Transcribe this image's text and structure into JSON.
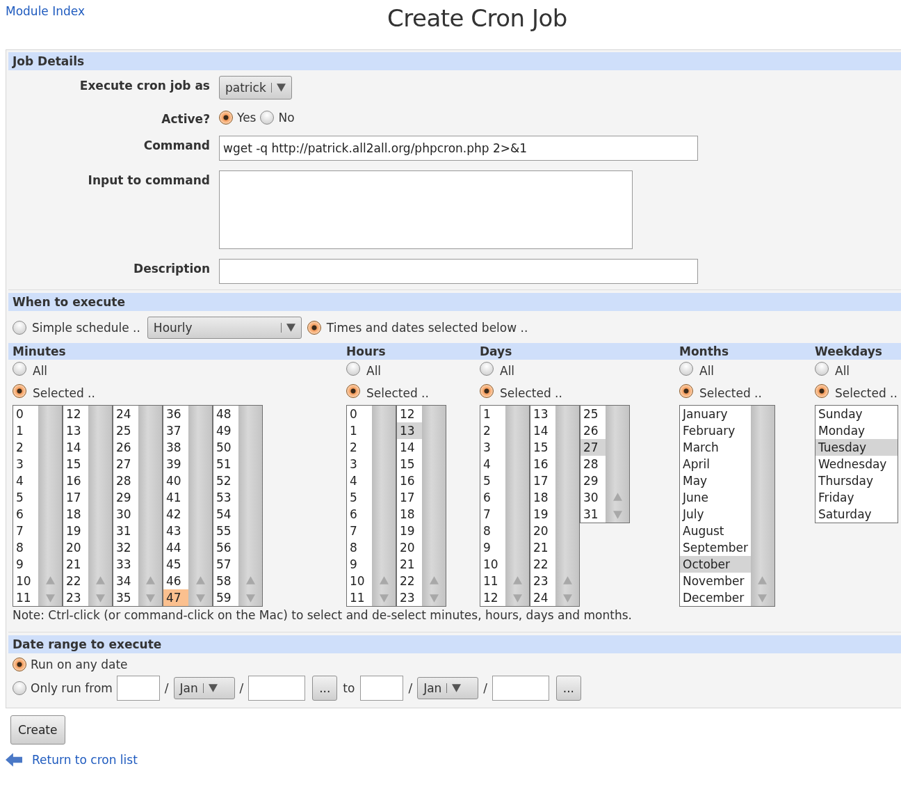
{
  "header": {
    "link": "Module Index",
    "title": "Create Cron Job"
  },
  "job_details": {
    "title": "Job Details",
    "user": {
      "label": "Execute cron job as",
      "value": "patrick"
    },
    "active": {
      "label": "Active?",
      "options": [
        {
          "label": "Yes",
          "selected": true
        },
        {
          "label": "No",
          "selected": false
        }
      ]
    },
    "command": {
      "label": "Command",
      "value": "wget -q http://patrick.all2all.org/phpcron.php 2>&1"
    },
    "input": {
      "label": "Input to command"
    },
    "description": {
      "label": "Description"
    }
  },
  "when": {
    "title": "When to execute",
    "modes": [
      {
        "kind": "simple",
        "label": "Simple schedule ..",
        "selected": false,
        "value": "Hourly"
      },
      {
        "kind": "times",
        "label": "Times and dates selected below ..",
        "selected": true
      }
    ],
    "groups": [
      {
        "title": "Minutes",
        "focused": true,
        "options": [
          {
            "label": "All",
            "selected": false
          },
          {
            "label": "Selected ..",
            "selected": true
          }
        ],
        "lists": [
          {
            "scrollbar": true,
            "items": [
              {
                "label": "0",
                "selected": false
              },
              {
                "label": "1",
                "selected": false
              },
              {
                "label": "2",
                "selected": false
              },
              {
                "label": "3",
                "selected": false
              },
              {
                "label": "4",
                "selected": false
              },
              {
                "label": "5",
                "selected": false
              },
              {
                "label": "6",
                "selected": false
              },
              {
                "label": "7",
                "selected": false
              },
              {
                "label": "8",
                "selected": false
              },
              {
                "label": "9",
                "selected": false
              },
              {
                "label": "10",
                "selected": false
              },
              {
                "label": "11",
                "selected": false
              }
            ]
          },
          {
            "scrollbar": true,
            "items": [
              {
                "label": "12",
                "selected": false
              },
              {
                "label": "13",
                "selected": false
              },
              {
                "label": "14",
                "selected": false
              },
              {
                "label": "15",
                "selected": false
              },
              {
                "label": "16",
                "selected": false
              },
              {
                "label": "17",
                "selected": false
              },
              {
                "label": "18",
                "selected": false
              },
              {
                "label": "19",
                "selected": false
              },
              {
                "label": "20",
                "selected": false
              },
              {
                "label": "21",
                "selected": false
              },
              {
                "label": "22",
                "selected": false
              },
              {
                "label": "23",
                "selected": false
              }
            ]
          },
          {
            "scrollbar": true,
            "items": [
              {
                "label": "24",
                "selected": false
              },
              {
                "label": "25",
                "selected": false
              },
              {
                "label": "26",
                "selected": false
              },
              {
                "label": "27",
                "selected": false
              },
              {
                "label": "28",
                "selected": false
              },
              {
                "label": "29",
                "selected": false
              },
              {
                "label": "30",
                "selected": false
              },
              {
                "label": "31",
                "selected": false
              },
              {
                "label": "32",
                "selected": false
              },
              {
                "label": "33",
                "selected": false
              },
              {
                "label": "34",
                "selected": false
              },
              {
                "label": "35",
                "selected": false
              }
            ]
          },
          {
            "scrollbar": true,
            "items": [
              {
                "label": "36",
                "selected": false
              },
              {
                "label": "37",
                "selected": false
              },
              {
                "label": "38",
                "selected": false
              },
              {
                "label": "39",
                "selected": false
              },
              {
                "label": "40",
                "selected": false
              },
              {
                "label": "41",
                "selected": false
              },
              {
                "label": "42",
                "selected": false
              },
              {
                "label": "43",
                "selected": false
              },
              {
                "label": "44",
                "selected": false
              },
              {
                "label": "45",
                "selected": false
              },
              {
                "label": "46",
                "selected": false
              },
              {
                "label": "47",
                "selected": true
              }
            ]
          },
          {
            "scrollbar": true,
            "items": [
              {
                "label": "48",
                "selected": false
              },
              {
                "label": "49",
                "selected": false
              },
              {
                "label": "50",
                "selected": false
              },
              {
                "label": "51",
                "selected": false
              },
              {
                "label": "52",
                "selected": false
              },
              {
                "label": "53",
                "selected": false
              },
              {
                "label": "54",
                "selected": false
              },
              {
                "label": "55",
                "selected": false
              },
              {
                "label": "56",
                "selected": false
              },
              {
                "label": "57",
                "selected": false
              },
              {
                "label": "58",
                "selected": false
              },
              {
                "label": "59",
                "selected": false
              }
            ]
          }
        ]
      },
      {
        "title": "Hours",
        "focused": false,
        "options": [
          {
            "label": "All",
            "selected": false
          },
          {
            "label": "Selected ..",
            "selected": true
          }
        ],
        "lists": [
          {
            "scrollbar": true,
            "items": [
              {
                "label": "0",
                "selected": false
              },
              {
                "label": "1",
                "selected": false
              },
              {
                "label": "2",
                "selected": false
              },
              {
                "label": "3",
                "selected": false
              },
              {
                "label": "4",
                "selected": false
              },
              {
                "label": "5",
                "selected": false
              },
              {
                "label": "6",
                "selected": false
              },
              {
                "label": "7",
                "selected": false
              },
              {
                "label": "8",
                "selected": false
              },
              {
                "label": "9",
                "selected": false
              },
              {
                "label": "10",
                "selected": false
              },
              {
                "label": "11",
                "selected": false
              }
            ]
          },
          {
            "scrollbar": true,
            "items": [
              {
                "label": "12",
                "selected": false
              },
              {
                "label": "13",
                "selected": true
              },
              {
                "label": "14",
                "selected": false
              },
              {
                "label": "15",
                "selected": false
              },
              {
                "label": "16",
                "selected": false
              },
              {
                "label": "17",
                "selected": false
              },
              {
                "label": "18",
                "selected": false
              },
              {
                "label": "19",
                "selected": false
              },
              {
                "label": "20",
                "selected": false
              },
              {
                "label": "21",
                "selected": false
              },
              {
                "label": "22",
                "selected": false
              },
              {
                "label": "23",
                "selected": false
              }
            ]
          }
        ]
      },
      {
        "title": "Days",
        "focused": false,
        "options": [
          {
            "label": "All",
            "selected": false
          },
          {
            "label": "Selected ..",
            "selected": true
          }
        ],
        "lists": [
          {
            "scrollbar": true,
            "items": [
              {
                "label": "1",
                "selected": false
              },
              {
                "label": "2",
                "selected": false
              },
              {
                "label": "3",
                "selected": false
              },
              {
                "label": "4",
                "selected": false
              },
              {
                "label": "5",
                "selected": false
              },
              {
                "label": "6",
                "selected": false
              },
              {
                "label": "7",
                "selected": false
              },
              {
                "label": "8",
                "selected": false
              },
              {
                "label": "9",
                "selected": false
              },
              {
                "label": "10",
                "selected": false
              },
              {
                "label": "11",
                "selected": false
              },
              {
                "label": "12",
                "selected": false
              }
            ]
          },
          {
            "scrollbar": true,
            "items": [
              {
                "label": "13",
                "selected": false
              },
              {
                "label": "14",
                "selected": false
              },
              {
                "label": "15",
                "selected": false
              },
              {
                "label": "16",
                "selected": false
              },
              {
                "label": "17",
                "selected": false
              },
              {
                "label": "18",
                "selected": false
              },
              {
                "label": "19",
                "selected": false
              },
              {
                "label": "20",
                "selected": false
              },
              {
                "label": "21",
                "selected": false
              },
              {
                "label": "22",
                "selected": false
              },
              {
                "label": "23",
                "selected": false
              },
              {
                "label": "24",
                "selected": false
              }
            ]
          },
          {
            "scrollbar": true,
            "items": [
              {
                "label": "25",
                "selected": false
              },
              {
                "label": "26",
                "selected": false
              },
              {
                "label": "27",
                "selected": true
              },
              {
                "label": "28",
                "selected": false
              },
              {
                "label": "29",
                "selected": false
              },
              {
                "label": "30",
                "selected": false
              },
              {
                "label": "31",
                "selected": false
              }
            ]
          }
        ]
      },
      {
        "title": "Months",
        "focused": false,
        "options": [
          {
            "label": "All",
            "selected": false
          },
          {
            "label": "Selected ..",
            "selected": true
          }
        ],
        "lists": [
          {
            "scrollbar": true,
            "items": [
              {
                "label": "January",
                "selected": false
              },
              {
                "label": "February",
                "selected": false
              },
              {
                "label": "March",
                "selected": false
              },
              {
                "label": "April",
                "selected": false
              },
              {
                "label": "May",
                "selected": false
              },
              {
                "label": "June",
                "selected": false
              },
              {
                "label": "July",
                "selected": false
              },
              {
                "label": "August",
                "selected": false
              },
              {
                "label": "September",
                "selected": false
              },
              {
                "label": "October",
                "selected": true
              },
              {
                "label": "November",
                "selected": false
              },
              {
                "label": "December",
                "selected": false
              }
            ]
          }
        ]
      },
      {
        "title": "Weekdays",
        "focused": false,
        "options": [
          {
            "label": "All",
            "selected": false
          },
          {
            "label": "Selected ..",
            "selected": true
          }
        ],
        "lists": [
          {
            "scrollbar": false,
            "items": [
              {
                "label": "Sunday",
                "selected": false
              },
              {
                "label": "Monday",
                "selected": false
              },
              {
                "label": "Tuesday",
                "selected": true
              },
              {
                "label": "Wednesday",
                "selected": false
              },
              {
                "label": "Thursday",
                "selected": false
              },
              {
                "label": "Friday",
                "selected": false
              },
              {
                "label": "Saturday",
                "selected": false
              }
            ]
          }
        ]
      }
    ],
    "note": "Note: Ctrl-click (or command-click on the Mac) to select and de-select minutes, hours, days and months."
  },
  "date_range": {
    "title": "Date range to execute",
    "options": [
      {
        "kind": "any",
        "label": "Run on any date",
        "selected": true
      },
      {
        "kind": "range",
        "label": "Only run from",
        "selected": false
      }
    ],
    "from": {
      "separator_1": "/",
      "month": "Jan",
      "separator_2": "/",
      "pick": "..."
    },
    "to_label": "to",
    "to": {
      "separator_1": "/",
      "month": "Jan",
      "separator_2": "/",
      "pick": "..."
    }
  },
  "create": "Create",
  "back_link": "Return to cron list"
}
